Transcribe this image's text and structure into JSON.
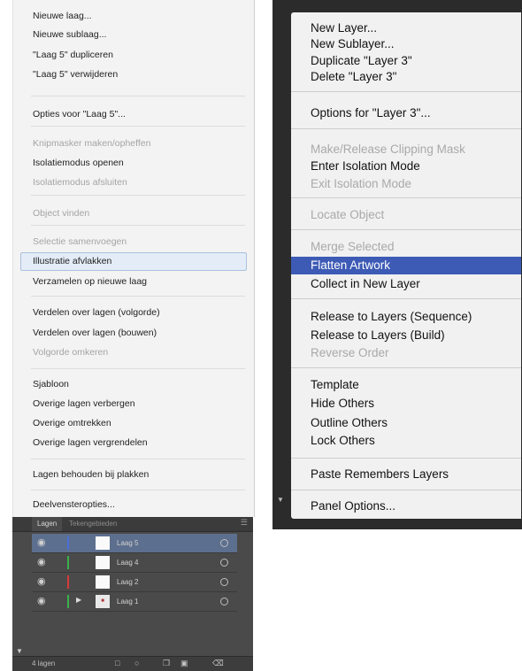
{
  "left_menu": {
    "items": [
      {
        "label": "Nieuwe laag...",
        "enabled": true
      },
      {
        "label": "Nieuwe sublaag...",
        "enabled": true
      },
      {
        "label": "\"Laag 5\" dupliceren",
        "enabled": true
      },
      {
        "label": "\"Laag 5\" verwijderen",
        "enabled": true
      },
      {
        "label": "Opties voor \"Laag 5\"...",
        "enabled": true
      },
      {
        "label": "Knipmasker maken/opheffen",
        "enabled": false
      },
      {
        "label": "Isolatiemodus openen",
        "enabled": true
      },
      {
        "label": "Isolatiemodus afsluiten",
        "enabled": false
      },
      {
        "label": "Object vinden",
        "enabled": false
      },
      {
        "label": "Selectie samenvoegen",
        "enabled": false
      },
      {
        "label": "Illustratie afvlakken",
        "enabled": true,
        "highlighted": true
      },
      {
        "label": "Verzamelen op nieuwe laag",
        "enabled": true
      },
      {
        "label": "Verdelen over lagen (volgorde)",
        "enabled": true
      },
      {
        "label": "Verdelen over lagen (bouwen)",
        "enabled": true
      },
      {
        "label": "Volgorde omkeren",
        "enabled": false
      },
      {
        "label": "Sjabloon",
        "enabled": true
      },
      {
        "label": "Overige lagen verbergen",
        "enabled": true
      },
      {
        "label": "Overige omtrekken",
        "enabled": true
      },
      {
        "label": "Overige lagen vergrendelen",
        "enabled": true
      },
      {
        "label": "Lagen behouden bij plakken",
        "enabled": true
      },
      {
        "label": "Deelvensteropties...",
        "enabled": true
      }
    ]
  },
  "layers_panel": {
    "tabs": [
      "Lagen",
      "Tekengebieden"
    ],
    "layers": [
      {
        "name": "Laag 5",
        "color": "#4a6fd8",
        "selected": true,
        "expandable": false
      },
      {
        "name": "Laag 4",
        "color": "#38b24a",
        "selected": false,
        "expandable": false
      },
      {
        "name": "Laag 2",
        "color": "#d83a3a",
        "selected": false,
        "expandable": false
      },
      {
        "name": "Laag 1",
        "color": "#38b24a",
        "selected": false,
        "expandable": true
      }
    ],
    "footer_count": "4 lagen"
  },
  "right_menu": {
    "items": [
      {
        "label": "New Layer...",
        "enabled": true
      },
      {
        "label": "New Sublayer...",
        "enabled": true
      },
      {
        "label": "Duplicate \"Layer 3\"",
        "enabled": true
      },
      {
        "label": "Delete \"Layer 3\"",
        "enabled": true
      },
      {
        "label": "Options for \"Layer 3\"...",
        "enabled": true
      },
      {
        "label": "Make/Release Clipping Mask",
        "enabled": false
      },
      {
        "label": "Enter Isolation Mode",
        "enabled": true
      },
      {
        "label": "Exit Isolation Mode",
        "enabled": false
      },
      {
        "label": "Locate Object",
        "enabled": false
      },
      {
        "label": "Merge Selected",
        "enabled": false
      },
      {
        "label": "Flatten Artwork",
        "enabled": true,
        "highlighted": true
      },
      {
        "label": "Collect in New Layer",
        "enabled": true
      },
      {
        "label": "Release to Layers (Sequence)",
        "enabled": true
      },
      {
        "label": "Release to Layers (Build)",
        "enabled": true
      },
      {
        "label": "Reverse Order",
        "enabled": false
      },
      {
        "label": "Template",
        "enabled": true
      },
      {
        "label": "Hide Others",
        "enabled": true
      },
      {
        "label": "Outline Others",
        "enabled": true
      },
      {
        "label": "Lock Others",
        "enabled": true
      },
      {
        "label": "Paste Remembers Layers",
        "enabled": true
      },
      {
        "label": "Panel Options...",
        "enabled": true
      }
    ]
  },
  "icons": {
    "eye": "eye-icon",
    "expand": "triangle-right-icon",
    "scroll_down": "triangle-down-icon",
    "panel_menu": "panel-menu-icon",
    "footer": [
      "clipping-mask-icon",
      "new-sublayer-icon",
      "new-layer-icon",
      "delete-icon"
    ]
  }
}
